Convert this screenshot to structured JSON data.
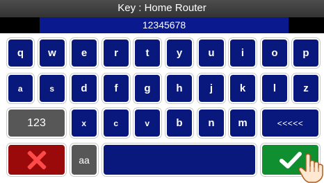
{
  "header": {
    "title": "Key : Home Router"
  },
  "entry": {
    "value": "12345678"
  },
  "keys": {
    "row1": [
      "q",
      "w",
      "e",
      "r",
      "t",
      "y",
      "u",
      "i",
      "o",
      "p"
    ],
    "row2": [
      "a",
      "s",
      "d",
      "f",
      "g",
      "h",
      "j",
      "k",
      "l",
      "z"
    ],
    "row3": [
      "123",
      "x",
      "c",
      "v",
      "b",
      "n",
      "m",
      "<<<<<"
    ],
    "row4": [
      "aa"
    ]
  },
  "icons": {
    "cancel": "close-x-icon",
    "ok": "checkmark-icon",
    "hand": "hand-pointer-icon"
  },
  "colors": {
    "key": "#09187c",
    "function_key": "#575757",
    "cancel": "#9a0a0a",
    "ok": "#0f8f2f",
    "title_bar": "#404040"
  }
}
